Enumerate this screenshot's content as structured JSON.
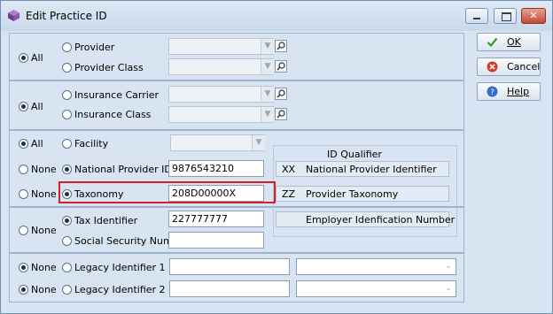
{
  "window": {
    "title": "Edit Practice ID"
  },
  "buttons": {
    "ok": "OK",
    "cancel": "Cancel",
    "help": "Help"
  },
  "groups": {
    "provider": {
      "all_label": "All",
      "option1": "Provider",
      "option2": "Provider Class"
    },
    "insurance": {
      "all_label": "All",
      "option1": "Insurance Carrier",
      "option2": "Insurance Class"
    },
    "facility": {
      "all_label": "All",
      "none_label": "None",
      "facility_label": "Facility",
      "npi_label": "National Provider ID",
      "npi_value": "9876543210",
      "taxonomy_label": "Taxonomy",
      "taxonomy_value": "208D00000X"
    },
    "tax": {
      "none_label": "None",
      "tax_label": "Tax Identifier",
      "tax_value": "227777777",
      "ssn_label": "Social Security Number",
      "ssn_value": ""
    },
    "legacy": {
      "none_label": "None",
      "legacy1_label": "Legacy Identifier 1",
      "legacy2_label": "Legacy Identifier 2"
    }
  },
  "id_qualifier": {
    "title": "ID Qualifier",
    "rows": [
      {
        "code": "XX",
        "text": "National Provider Identifier"
      },
      {
        "code": "ZZ",
        "text": "Provider Taxonomy"
      },
      {
        "code": "",
        "text": "Employer Idenfication Number"
      }
    ]
  },
  "colors": {
    "highlight": "#d0242a",
    "window_bg": "#d8e4f1"
  },
  "icons": {
    "app": "app-cube-icon",
    "ok": "checkmark-icon",
    "cancel": "cancel-icon",
    "help": "help-icon"
  }
}
